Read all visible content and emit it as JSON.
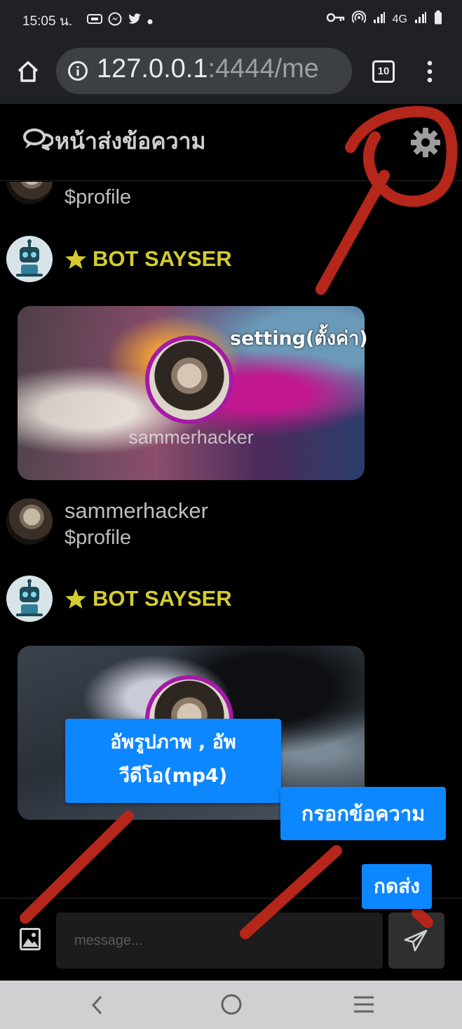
{
  "status_bar": {
    "time": "15:05 น.",
    "network": "4G",
    "icons": [
      "sim-icon",
      "messenger-icon",
      "twitter-icon",
      "dot-icon",
      "key-icon",
      "hotspot-icon",
      "signal-icon",
      "battery-icon"
    ]
  },
  "browser": {
    "url_host": "127.0.0.1",
    "url_rest": ":4444/me",
    "tab_count": "10"
  },
  "app": {
    "title": "หน้าส่งข้อความ"
  },
  "messages": [
    {
      "type": "user",
      "name": "",
      "status": "$profile"
    },
    {
      "type": "bot",
      "name": "BOT SAYSER",
      "card_name": "sammerhacker"
    },
    {
      "type": "user",
      "name": "sammerhacker",
      "status": "$profile"
    },
    {
      "type": "bot",
      "name": "BOT SAYSER",
      "card_name": ""
    }
  ],
  "annotations": {
    "setting": "setting(ตั้งค่า)",
    "upload_line1": "อัพรูปภาพ , อัพ",
    "upload_line2": "วีดีโอ(mp4)",
    "type_message": "กรอกข้อความ",
    "send": "กดส่ง"
  },
  "input": {
    "placeholder": "message..."
  },
  "colors": {
    "bot_name": "#d4cc2e",
    "avatar_ring": "#a51aa6",
    "annotation_bubble": "#0d87ff",
    "annotation_stroke": "#b5261b"
  }
}
